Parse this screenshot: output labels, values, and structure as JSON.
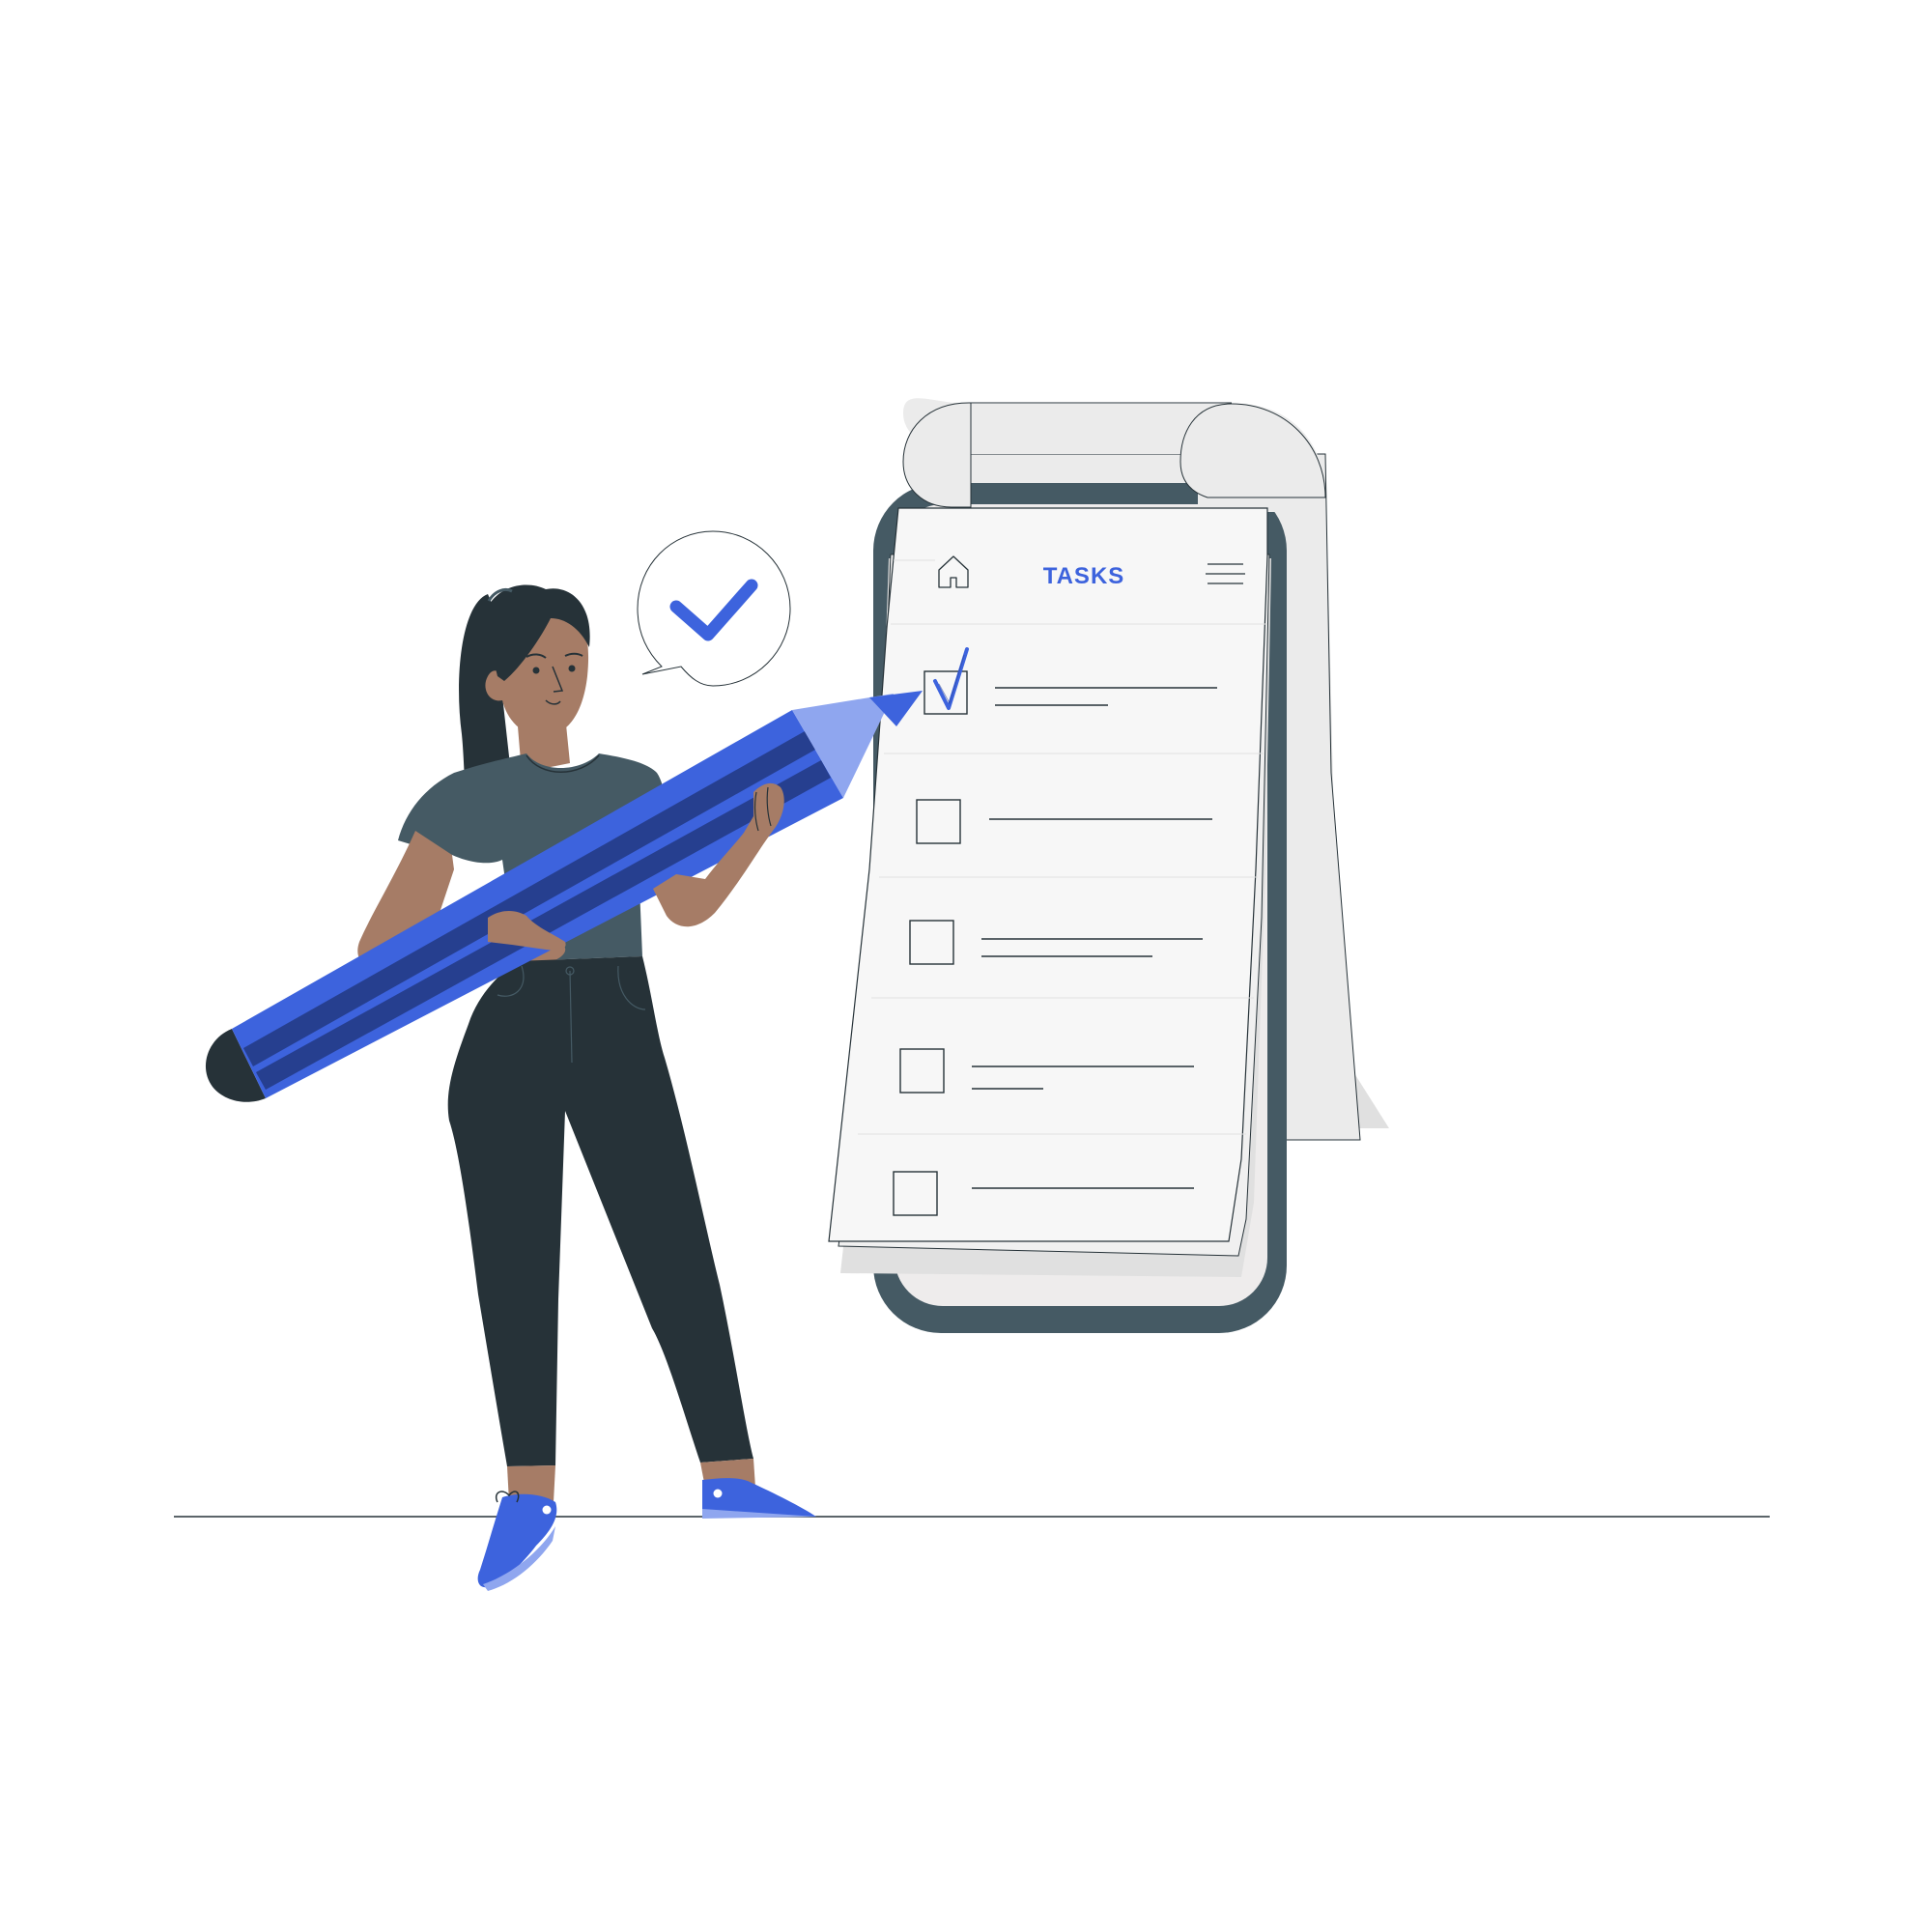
{
  "app": {
    "title": "TASKS"
  },
  "tasks": [
    {
      "checked": true
    },
    {
      "checked": false
    },
    {
      "checked": false
    },
    {
      "checked": false
    },
    {
      "checked": false
    }
  ],
  "icons": {
    "home": "home-icon",
    "menu": "hamburger-menu-icon",
    "bubble_check": "checkmark-icon"
  },
  "colors": {
    "accent": "#3D63DD",
    "accent_light": "#8FA6EF",
    "accent_dark": "#263F8F",
    "phone_frame": "#455A64",
    "paper": "#F7F7F7",
    "paper_back": "#EBEBEB",
    "skin": "#A67C66",
    "hair": "#263238",
    "shirt": "#455A64",
    "pants": "#263238"
  }
}
